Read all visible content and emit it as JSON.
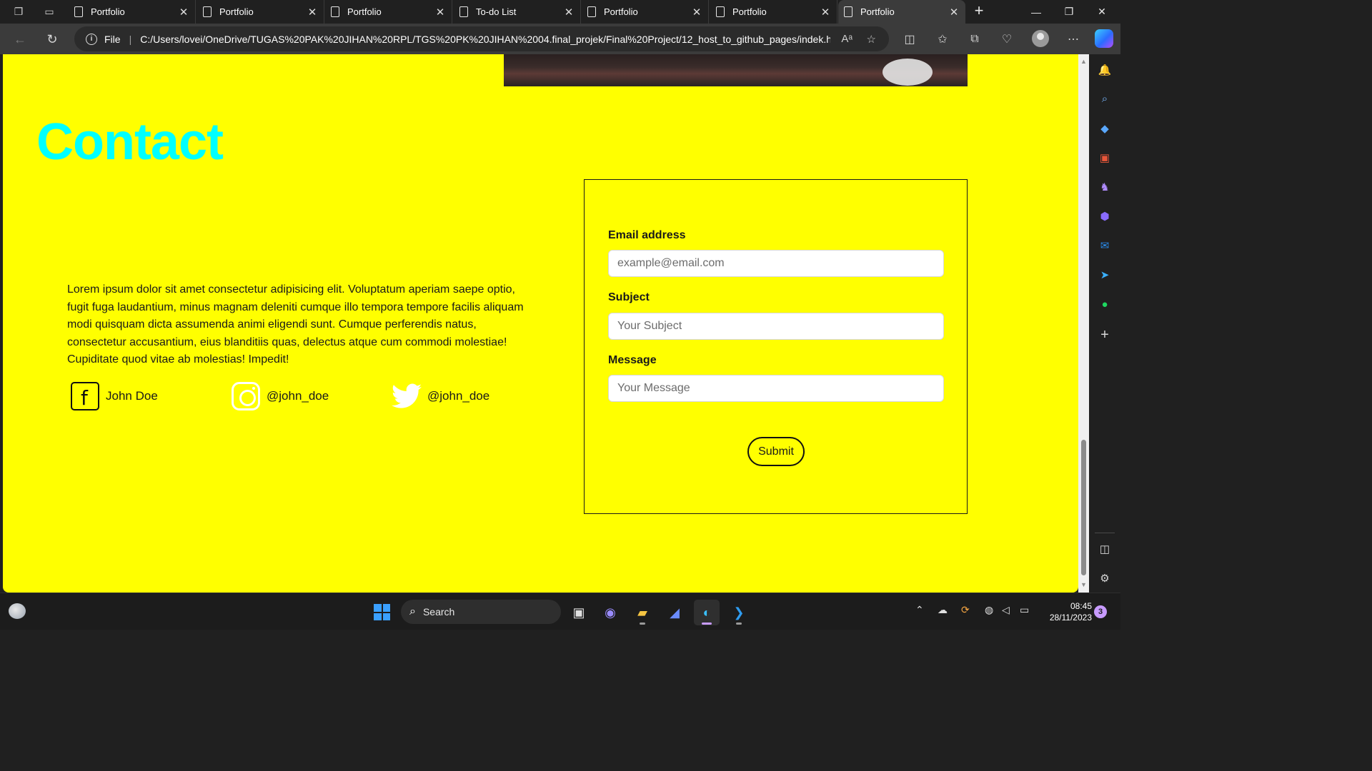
{
  "browser": {
    "tabs": [
      {
        "title": "Portfolio",
        "active": false
      },
      {
        "title": "Portfolio",
        "active": false
      },
      {
        "title": "Portfolio",
        "active": false
      },
      {
        "title": "To-do List",
        "active": false
      },
      {
        "title": "Portfolio",
        "active": false
      },
      {
        "title": "Portfolio",
        "active": false
      },
      {
        "title": "Portfolio",
        "active": true
      }
    ],
    "address": {
      "scheme": "File",
      "url": "C:/Users/lovei/OneDrive/TUGAS%20PAK%20JIHAN%20RPL/TGS%20PK%20JIHAN%2004.final_projek/Final%20Project/12_host_to_github_pages/indek.ht..."
    },
    "read_aloud_glyph": "Aᵃ"
  },
  "page": {
    "contact_title": "Contact",
    "about_text": "Lorem ipsum dolor sit amet consectetur adipisicing elit. Voluptatum aperiam saepe optio, fugit fuga laudantium, minus magnam deleniti cumque illo tempora tempore facilis aliquam modi quisquam dicta assumenda animi eligendi sunt. Cumque perferendis natus, consectetur accusantium, eius blanditiis quas, delectus atque cum commodi molestiae! Cupiditate quod vitae ab molestias! Impedit!",
    "socials": [
      {
        "icon": "facebook-icon",
        "label": "John Doe"
      },
      {
        "icon": "instagram-icon",
        "label": "@john_doe"
      },
      {
        "icon": "twitter-icon",
        "label": "@john_doe"
      }
    ],
    "form": {
      "email_label": "Email address",
      "email_placeholder": "example@email.com",
      "subject_label": "Subject",
      "subject_placeholder": "Your Subject",
      "message_label": "Message",
      "message_placeholder": "Your Message",
      "submit_label": "Submit"
    },
    "colors": {
      "background": "#ffff00",
      "title": "#00ffff",
      "instagram_icon": "#ffffff"
    }
  },
  "taskbar": {
    "search_label": "Search",
    "time": "08:45",
    "date": "28/11/2023",
    "notification_count": "3"
  }
}
